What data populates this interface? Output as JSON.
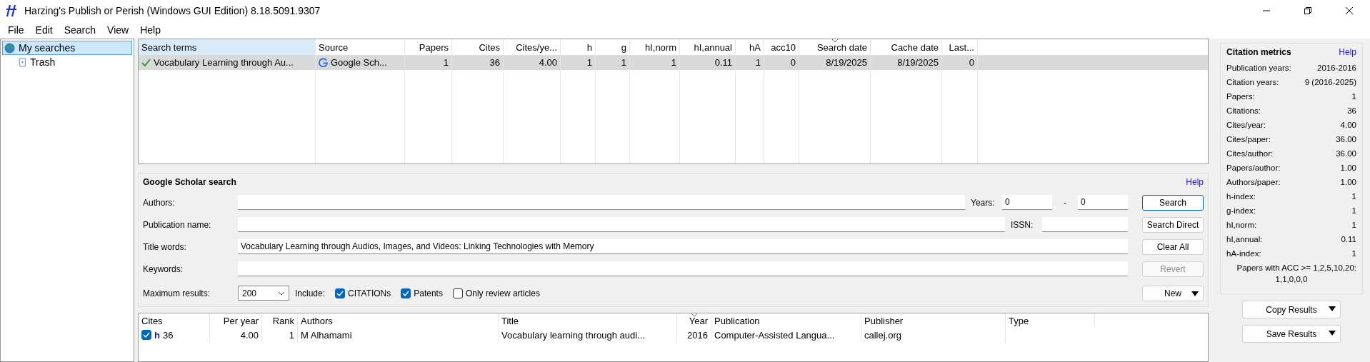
{
  "window": {
    "title": "Harzing's Publish or Perish (Windows GUI Edition) 8.18.5091.9307"
  },
  "menu": [
    "File",
    "Edit",
    "Search",
    "View",
    "Help"
  ],
  "tree": [
    {
      "label": "My searches",
      "kind": "globe",
      "selected": true,
      "children": [
        {
          "label": "Trash",
          "kind": "trash",
          "selected": false
        }
      ]
    }
  ],
  "searches_table": {
    "columns": [
      {
        "label": "Search terms",
        "sorted": false
      },
      {
        "label": "Source",
        "sorted": false
      },
      {
        "label": "Papers",
        "sorted": false
      },
      {
        "label": "Cites",
        "sorted": false
      },
      {
        "label": "Cites/ye...",
        "sorted": false
      },
      {
        "label": "h",
        "sorted": false
      },
      {
        "label": "g",
        "sorted": false
      },
      {
        "label": "hI,norm",
        "sorted": false
      },
      {
        "label": "hI,annual",
        "sorted": false
      },
      {
        "label": "hA",
        "sorted": false
      },
      {
        "label": "acc10",
        "sorted": false
      },
      {
        "label": "Search date",
        "sorted": true
      },
      {
        "label": "Cache date",
        "sorted": false
      },
      {
        "label": "Last...",
        "sorted": false
      }
    ],
    "rows": [
      {
        "selected": true,
        "cells": [
          "Vocabulary Learning through Au...",
          "Google Sch...",
          "1",
          "36",
          "4.00",
          "1",
          "1",
          "1",
          "0.11",
          "1",
          "0",
          "8/19/2025",
          "8/19/2025",
          "0"
        ]
      }
    ]
  },
  "search_form": {
    "title": "Google Scholar search",
    "help": "Help",
    "authors": {
      "label": "Authors:"
    },
    "publication": {
      "label": "Publication name:"
    },
    "title_words": {
      "label": "Title words:",
      "value": "Vocabulary Learning through Audios, Images, and Videos: Linking Technologies with Memory"
    },
    "keywords": {
      "label": "Keywords:"
    },
    "years": {
      "label": "Years:",
      "from": "0",
      "separator": "-",
      "to": "0"
    },
    "issn": {
      "label": "ISSN:"
    },
    "max_results": {
      "label": "Maximum results:",
      "value": "200"
    },
    "include_label": "Include:",
    "include": [
      {
        "label": "CITATIONs",
        "checked": true
      },
      {
        "label": "Patents",
        "checked": true
      },
      {
        "label": "Only review articles",
        "checked": false
      }
    ],
    "buttons": [
      {
        "label": "Search",
        "disabled": false,
        "focused": true,
        "menu": false
      },
      {
        "label": "Search Direct",
        "disabled": false,
        "focused": false,
        "menu": false
      },
      {
        "label": "Clear All",
        "disabled": false,
        "focused": false,
        "menu": false
      },
      {
        "label": "Revert",
        "disabled": true,
        "focused": false,
        "menu": false
      },
      {
        "label": "New",
        "disabled": false,
        "focused": false,
        "menu": true
      }
    ]
  },
  "metrics": {
    "title": "Citation metrics",
    "help": "Help",
    "items": [
      {
        "label": "Publication years:",
        "value": "2016-2016"
      },
      {
        "label": "Citation years:",
        "value": "9 (2016-2025)"
      },
      {
        "label": "Papers:",
        "value": "1"
      },
      {
        "label": "Citations:",
        "value": "36"
      },
      {
        "label": "Cites/year:",
        "value": "4.00"
      },
      {
        "label": "Cites/paper:",
        "value": "36.00"
      },
      {
        "label": "Cites/author:",
        "value": "36.00"
      },
      {
        "label": "Papers/author:",
        "value": "1.00"
      },
      {
        "label": "Authors/paper:",
        "value": "1.00"
      },
      {
        "label": "h-index:",
        "value": "1"
      },
      {
        "label": "g-index:",
        "value": "1"
      },
      {
        "label": "hI,norm:",
        "value": "1"
      },
      {
        "label": "hI,annual:",
        "value": "0.11"
      },
      {
        "label": "hA-index:",
        "value": "1"
      }
    ],
    "acc_label": "Papers with ACC >= 1,2,5,10,20:",
    "acc_value": "1,1,0,0,0",
    "buttons": [
      "Copy Results",
      "Save Results"
    ]
  },
  "results_table": {
    "columns": [
      {
        "label": "Cites",
        "sorted": false
      },
      {
        "label": "Per year",
        "sorted": false
      },
      {
        "label": "Rank",
        "sorted": false
      },
      {
        "label": "Authors",
        "sorted": false
      },
      {
        "label": "Title",
        "sorted": false
      },
      {
        "label": "Year",
        "sorted": true
      },
      {
        "label": "Publication",
        "sorted": false
      },
      {
        "label": "Publisher",
        "sorted": false
      },
      {
        "label": "Type",
        "sorted": false
      }
    ],
    "rows": [
      {
        "checked": true,
        "h_core": true,
        "h_mark": "h",
        "cells": [
          "36",
          "4.00",
          "1",
          "M Alhamami",
          "Vocabulary learning through audi...",
          "2016",
          "Computer-Assisted Langua...",
          "callej.org"
        ]
      }
    ]
  }
}
